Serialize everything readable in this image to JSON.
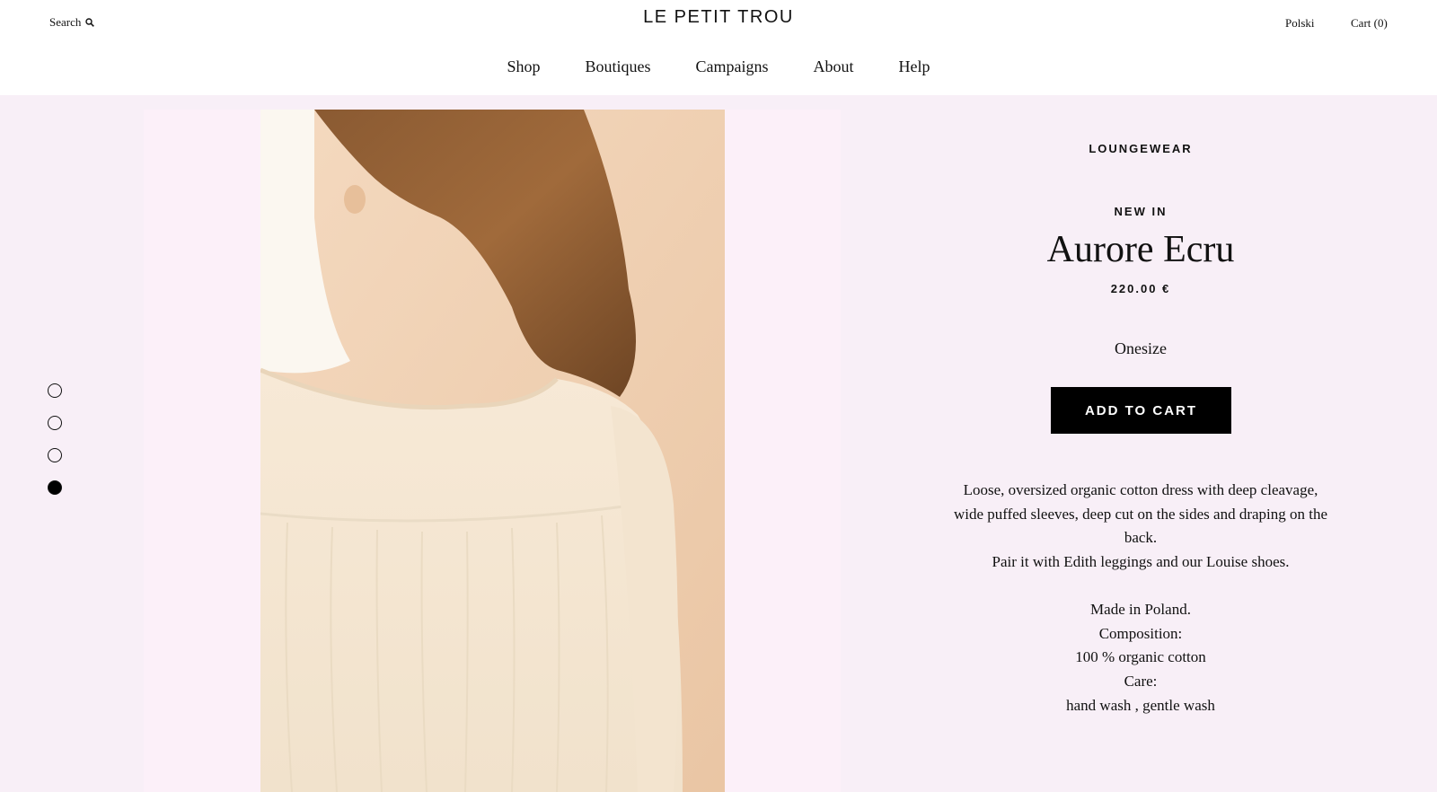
{
  "header": {
    "search_label": "Search",
    "brand": "LE PETIT TROU",
    "language": "Polski",
    "cart_label": "Cart (0)",
    "nav": [
      "Shop",
      "Boutiques",
      "Campaigns",
      "About",
      "Help"
    ]
  },
  "gallery": {
    "image_count": 4,
    "active_index": 4
  },
  "product": {
    "collection": "LOUNGEWEAR",
    "badge": "NEW IN",
    "title": "Aurore Ecru",
    "price": "220.00 €",
    "size": "Onesize",
    "add_to_cart": "ADD TO CART",
    "description": {
      "line1": "Loose, oversized organic cotton dress with deep cleavage,",
      "line2": "wide puffed sleeves, deep cut on the sides and draping on the",
      "line3": "back.",
      "line4": "Pair it with Edith leggings and our Louise shoes.",
      "line5": "Made in Poland.",
      "line6": "Composition:",
      "line7": "100 % organic cotton",
      "line8": "Care:",
      "line9": "hand wash , gentle wash"
    }
  },
  "colors": {
    "page_background": "#f8eff7",
    "image_frame": "#fcf0f9",
    "button": "#000000",
    "header": "#ffffff"
  }
}
